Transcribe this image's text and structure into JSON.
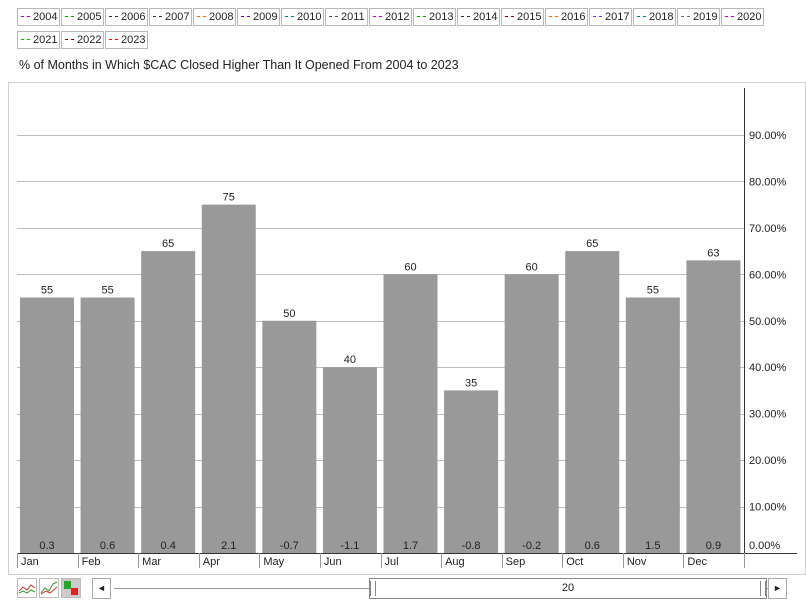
{
  "legend": [
    {
      "label": "2004",
      "color": "#c000c0"
    },
    {
      "label": "2005",
      "color": "#00a000"
    },
    {
      "label": "2006",
      "color": "#333333"
    },
    {
      "label": "2007",
      "color": "#333333"
    },
    {
      "label": "2008",
      "color": "#ff6600"
    },
    {
      "label": "2009",
      "color": "#6600cc"
    },
    {
      "label": "2010",
      "color": "#008080"
    },
    {
      "label": "2011",
      "color": "#555555"
    },
    {
      "label": "2012",
      "color": "#cc00cc"
    },
    {
      "label": "2013",
      "color": "#00a000"
    },
    {
      "label": "2014",
      "color": "#333333"
    },
    {
      "label": "2015",
      "color": "#800000"
    },
    {
      "label": "2016",
      "color": "#ff6600"
    },
    {
      "label": "2017",
      "color": "#6633ff"
    },
    {
      "label": "2018",
      "color": "#008080"
    },
    {
      "label": "2019",
      "color": "#666666"
    },
    {
      "label": "2020",
      "color": "#cc00cc"
    },
    {
      "label": "2021",
      "color": "#00c000"
    },
    {
      "label": "2022",
      "color": "#800000"
    },
    {
      "label": "2023",
      "color": "#ff0000"
    }
  ],
  "title": "% of Months in Which $CAC Closed Higher Than It Opened From 2004 to 2023",
  "scrollbar": {
    "value": "20",
    "left_arrow": "◄",
    "right_arrow": "►"
  },
  "toolbar": {
    "icons": [
      "line-chart-icon",
      "multi-line-chart-icon",
      "seasonality-bar-icon"
    ]
  },
  "chart_data": {
    "type": "bar",
    "title": "% of Months in Which $CAC Closed Higher Than It Opened From 2004 to 2023",
    "categories": [
      "Jan",
      "Feb",
      "Mar",
      "Apr",
      "May",
      "Jun",
      "Jul",
      "Aug",
      "Sep",
      "Oct",
      "Nov",
      "Dec"
    ],
    "values": [
      55,
      55,
      65,
      75,
      50,
      40,
      60,
      35,
      60,
      65,
      55,
      63
    ],
    "avg_change": [
      "0.3",
      "0.6",
      "0.4",
      "2.1",
      "-0.7",
      "-1.1",
      "1.7",
      "-0.8",
      "-0.2",
      "0.6",
      "1.5",
      "0.9"
    ],
    "ylim": [
      0,
      100
    ],
    "yticks": [
      "0.00%",
      "10.00%",
      "20.00%",
      "30.00%",
      "40.00%",
      "50.00%",
      "60.00%",
      "70.00%",
      "80.00%",
      "90.00%"
    ],
    "bar_color": "#999999",
    "grid": true,
    "axis_position": "right"
  }
}
